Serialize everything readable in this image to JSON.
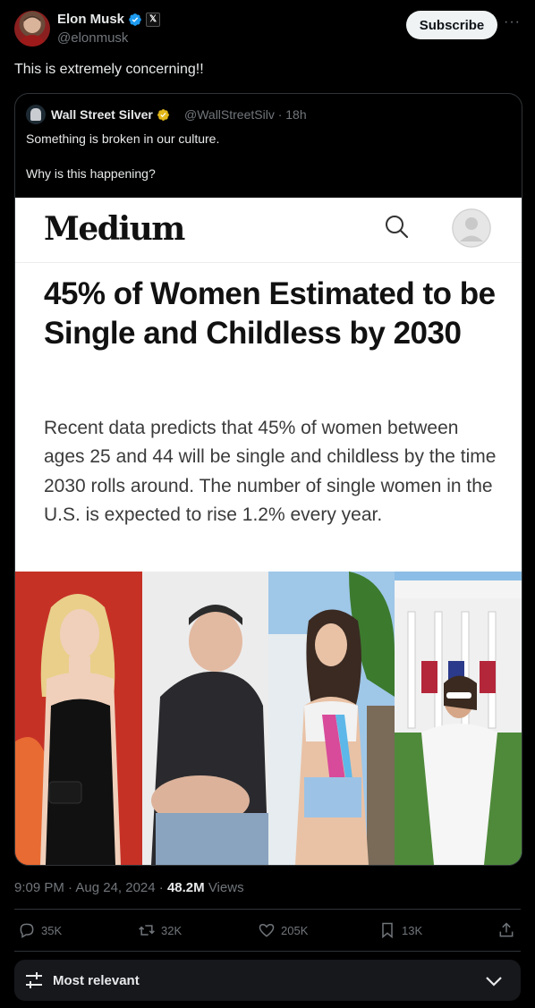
{
  "author": {
    "name": "Elon Musk",
    "handle": "@elonmusk",
    "badge_letter": "𝕏"
  },
  "subscribe_label": "Subscribe",
  "more_label": "···",
  "tweet_text": "This is extremely concerning!!",
  "quote": {
    "name": "Wall Street Silver",
    "meta": "@WallStreetSilv · 18h",
    "line1": "Something is broken in our culture.",
    "line2": "Why is this happening?"
  },
  "article": {
    "site": "Medium",
    "headline": "45% of Women Estimated to be Single and Childless by 2030",
    "subtext": "Recent data predicts that 45% of women between ages 25 and 44 will be single and childless by the time 2030 rolls around. The number of single women in the U.S. is expected to rise 1.2% every year."
  },
  "footer": {
    "time": "9:09 PM · Aug 24, 2024 · ",
    "views_count": "48.2M",
    "views_label": " Views"
  },
  "actions": {
    "replies": "35K",
    "reposts": "32K",
    "likes": "205K",
    "bookmarks": "13K"
  },
  "sort": {
    "label": "Most relevant"
  },
  "colors": {
    "background": "#000000",
    "text": "#e7e9ea",
    "muted": "#71767b",
    "verified_blue": "#1d9bf0",
    "verified_gold": "#e2b719",
    "border": "#2f3336"
  }
}
